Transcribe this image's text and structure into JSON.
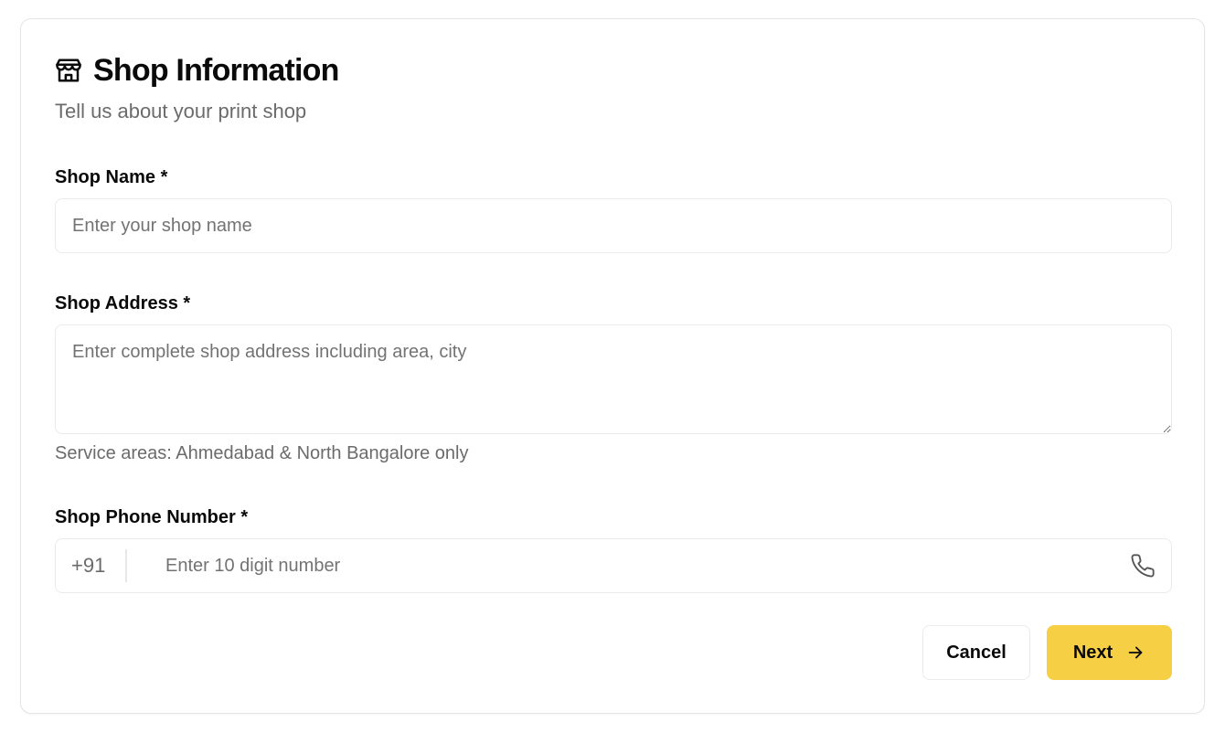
{
  "header": {
    "icon": "store-icon",
    "title": "Shop Information",
    "subtitle": "Tell us about your print shop"
  },
  "form": {
    "shop_name": {
      "label": "Shop Name *",
      "value": "",
      "placeholder": "Enter your shop name"
    },
    "shop_address": {
      "label": "Shop Address *",
      "value": "",
      "placeholder": "Enter complete shop address including area, city",
      "hint": "Service areas: Ahmedabad & North Bangalore only"
    },
    "shop_phone": {
      "label": "Shop Phone Number *",
      "prefix": "+91",
      "value": "",
      "placeholder": "Enter 10 digit number",
      "icon": "phone-icon"
    }
  },
  "actions": {
    "cancel_label": "Cancel",
    "next_label": "Next",
    "next_icon": "arrow-right-icon"
  },
  "colors": {
    "accent": "#f7cf45",
    "border": "#ebebeb",
    "muted_text": "#6b6b6b",
    "text": "#0a0a0a"
  }
}
